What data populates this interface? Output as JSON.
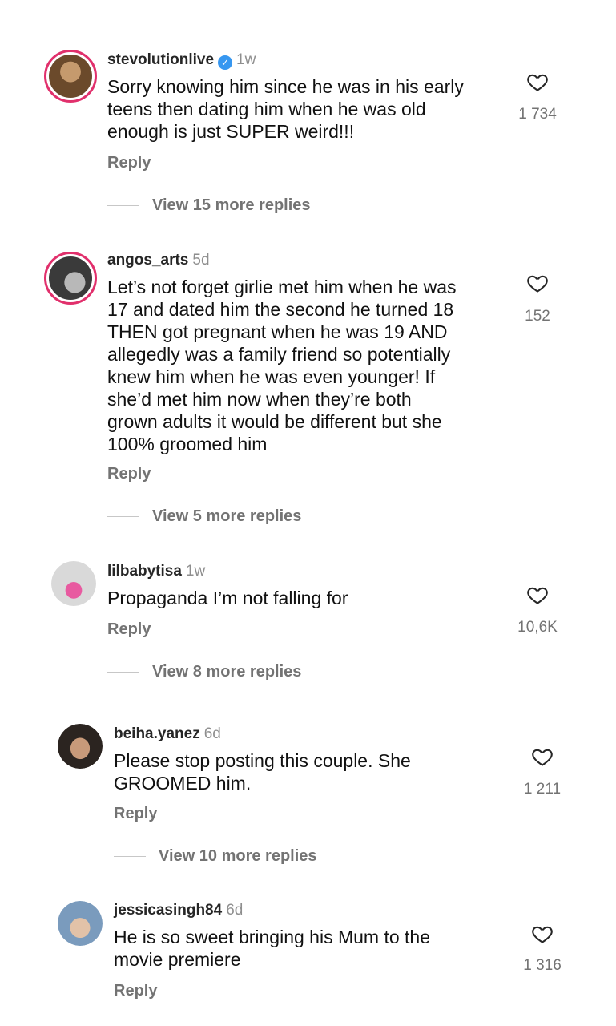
{
  "comments": [
    {
      "username": "stevolutionlive",
      "verified": true,
      "time": "1w",
      "lines": [
        "Sorry knowing him since he was in his early",
        "teens then dating him when he was old",
        "enough is just SUPER weird!!!"
      ],
      "likes": "1 734",
      "reply_label": "Reply",
      "more_replies": "View 15 more replies",
      "avatar_colors": [
        "#6b4a2b",
        "#c59a6d"
      ],
      "avatar_ring": true
    },
    {
      "username": "angos_arts",
      "verified": false,
      "time": "5d",
      "lines": [
        "Let’s not forget girlie met him when he was",
        "17 and dated him the second he turned 18",
        "THEN got pregnant when he was 19 AND",
        "allegedly was a family friend so potentially",
        "knew him when he was even younger! If",
        "she’d met him now when they’re both",
        "grown adults it would be different but she",
        "100% groomed him"
      ],
      "likes": "152",
      "reply_label": "Reply",
      "more_replies": "View 5 more replies",
      "avatar_colors": [
        "#3a3a3a",
        "#b8b8b8"
      ],
      "avatar_ring": true
    },
    {
      "username": "lilbabytisa",
      "verified": false,
      "time": "1w",
      "lines": [
        "Propaganda I’m not falling for"
      ],
      "likes": "10,6K",
      "reply_label": "Reply",
      "more_replies": "View 8 more replies",
      "avatar_colors": [
        "#d9d9d9",
        "#e85aa0"
      ],
      "avatar_ring": false
    },
    {
      "username": "beiha.yanez",
      "verified": false,
      "time": "6d",
      "lines": [
        "Please stop posting this couple. She",
        "GROOMED him."
      ],
      "likes": "1 211",
      "reply_label": "Reply",
      "more_replies": "View 10 more replies",
      "avatar_colors": [
        "#2b2420",
        "#c89a7a"
      ],
      "avatar_ring": false
    },
    {
      "username": "jessicasingh84",
      "verified": false,
      "time": "6d",
      "lines": [
        "He is so sweet bringing his Mum to the",
        "movie premiere"
      ],
      "likes": "1 316",
      "reply_label": "Reply",
      "more_replies": "",
      "avatar_colors": [
        "#7a9bbd",
        "#e2c2a8"
      ],
      "avatar_ring": false
    }
  ],
  "icons": {
    "heart": "heart-icon",
    "verified": "verified-badge-icon"
  }
}
